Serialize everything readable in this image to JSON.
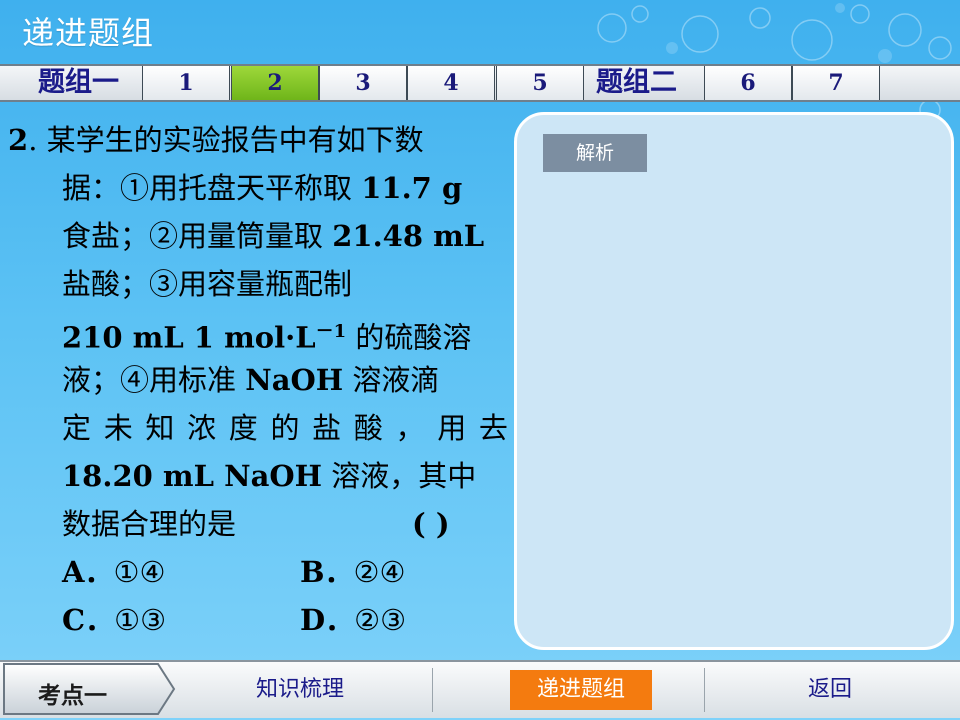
{
  "header": {
    "title": "递进题组"
  },
  "tabs": {
    "group1_label": "题组一",
    "group2_label": "题组二",
    "group1_items": [
      "1",
      "2",
      "3",
      "4",
      "5"
    ],
    "group2_items": [
      "6",
      "7"
    ],
    "active": "2"
  },
  "question": {
    "number": "2",
    "line1": ". 某学生的实验报告中有如下数",
    "line2_a": "据：①用托盘天平称取 ",
    "line2_b": "11.7 g",
    "line3_a": "食盐；②用量筒量取 ",
    "line3_b": "21.48 mL",
    "line4": "盐酸；③用容量瓶配制",
    "line5_a": "210  mL  1  mol·L",
    "line5_sup": "－1",
    "line5_b": " 的硫酸溶",
    "line6_a": "液；④用标准 ",
    "line6_b": "NaOH",
    "line6_c": " 溶液滴",
    "line7_chars": [
      "定",
      "未",
      "知",
      "浓",
      "度",
      "的",
      "盐",
      "酸",
      "，",
      "用",
      "去"
    ],
    "line8_a": "18.20  mL  NaOH",
    "line8_b": " 溶液，其中",
    "line9": "数据合理的是",
    "paren": "(        )",
    "options": [
      {
        "letter": "A．",
        "text": "①④"
      },
      {
        "letter": "B．",
        "text": "②④"
      },
      {
        "letter": "C．",
        "text": "①③"
      },
      {
        "letter": "D．",
        "text": "②③"
      }
    ]
  },
  "analysis_button": "解析",
  "bottom_nav": {
    "section": "考点一",
    "items": [
      "知识梳理",
      "递进题组",
      "返回"
    ],
    "active": "递进题组"
  },
  "colors": {
    "background": "#5cc2f4",
    "active_tab": "#8ccb2e",
    "active_nav": "#f47b0f",
    "tab_text": "#1b1b8a",
    "analysis_button": "#7c8ea1"
  }
}
